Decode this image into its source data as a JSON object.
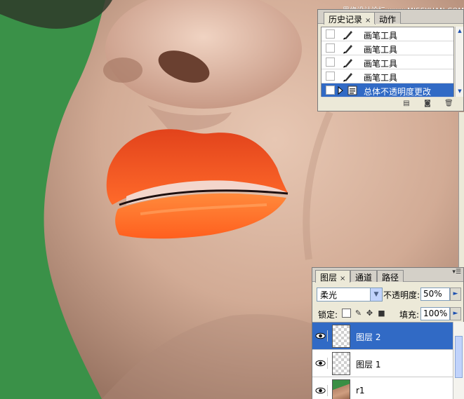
{
  "watermark": "思缘设计论坛 www.MISSYUAN.COM",
  "history_panel": {
    "tabs": [
      {
        "label": "历史记录",
        "close": "×"
      },
      {
        "label": "动作"
      }
    ],
    "items": [
      {
        "label": "画笔工具",
        "icon": "brush-icon"
      },
      {
        "label": "画笔工具",
        "icon": "brush-icon"
      },
      {
        "label": "画笔工具",
        "icon": "brush-icon"
      },
      {
        "label": "画笔工具",
        "icon": "brush-icon"
      },
      {
        "label": "总体不透明度更改",
        "icon": "history-step-icon",
        "selected": true
      }
    ],
    "footer_icons": [
      "new-document-from-state-icon",
      "new-snapshot-icon",
      "trash-icon"
    ]
  },
  "layers_panel": {
    "tabs": [
      {
        "label": "图层",
        "close": "×"
      },
      {
        "label": "通道"
      },
      {
        "label": "路径"
      }
    ],
    "blend_mode": "柔光",
    "opacity_label": "不透明度:",
    "opacity_value": "50%",
    "lock_label": "锁定:",
    "fill_label": "填充:",
    "fill_value": "100%",
    "lock_icons": [
      "lock-transparency-icon",
      "lock-image-icon",
      "lock-position-icon",
      "lock-all-icon"
    ],
    "layers": [
      {
        "name": "图层 2",
        "selected": true,
        "thumb": "transparent"
      },
      {
        "name": "图层 1",
        "selected": false,
        "thumb": "transparent"
      },
      {
        "name": "r1",
        "selected": false,
        "thumb": "photo"
      }
    ]
  },
  "colors": {
    "background_green": "#3a9148",
    "lip_orange": "#ff6a2a",
    "selection_blue": "#316ac5",
    "panel_bg": "#ece9d8"
  }
}
